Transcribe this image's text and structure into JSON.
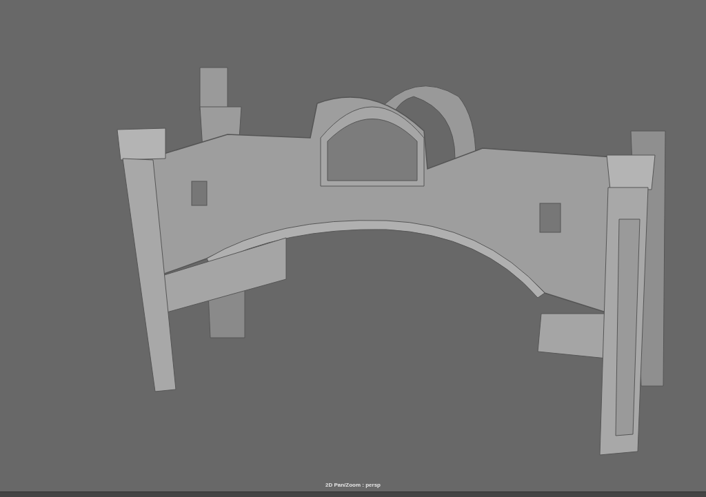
{
  "viewport": {
    "camera_label": "2D Pan/Zoom : persp"
  }
}
